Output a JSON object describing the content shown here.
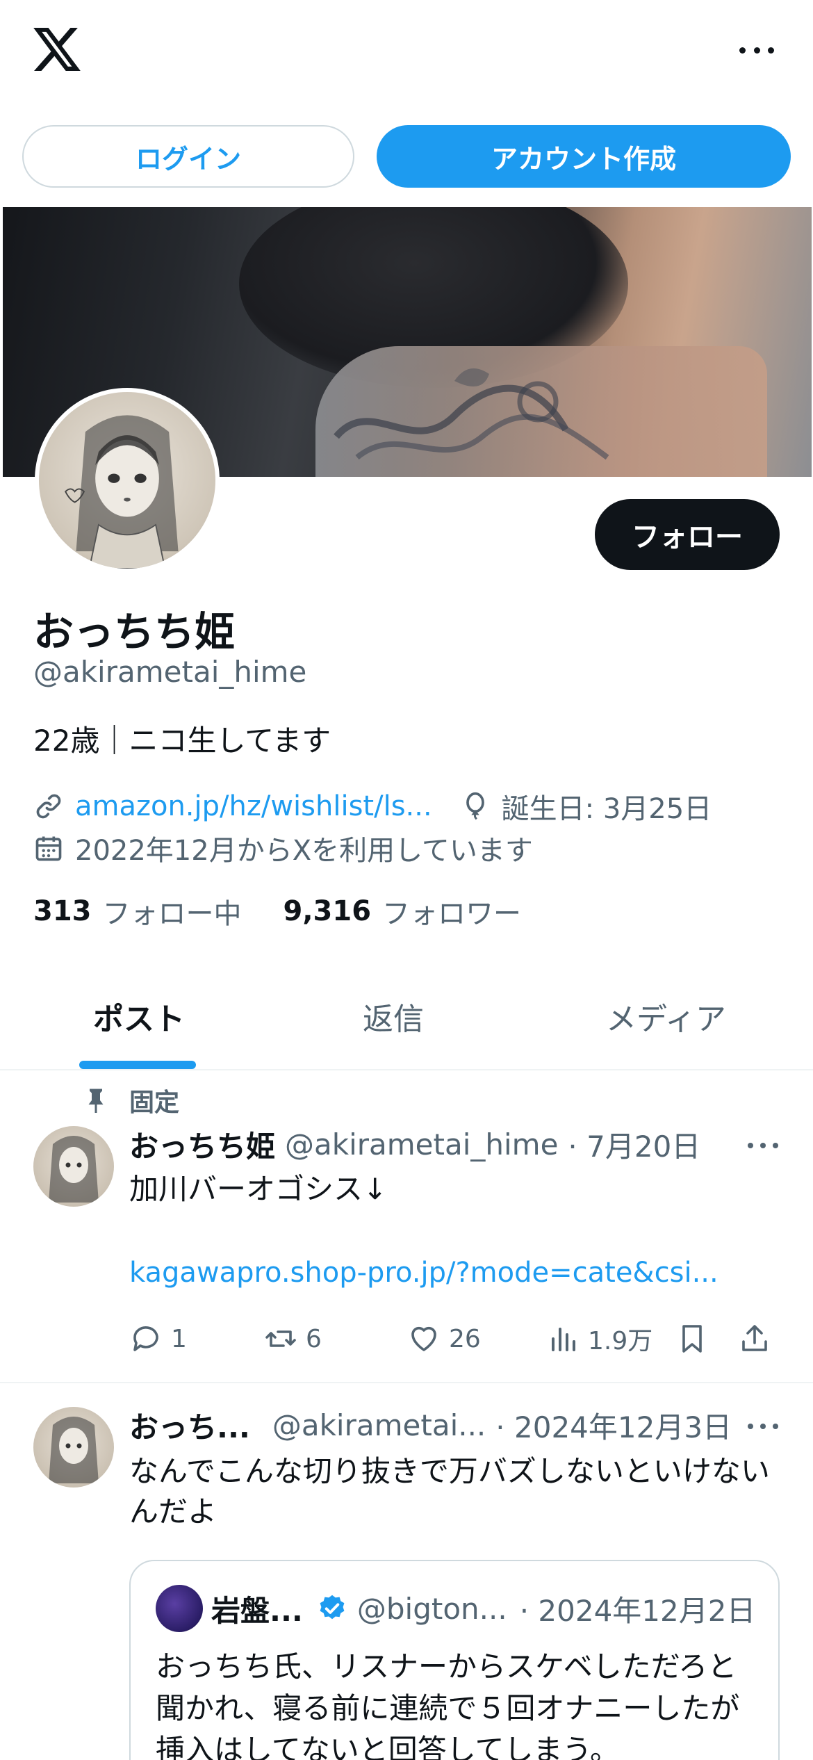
{
  "auth": {
    "login_label": "ログイン",
    "signup_label": "アカウント作成"
  },
  "profile": {
    "display_name": "おっちち姫",
    "handle": "@akirametai_hime",
    "bio": "22歳｜ニコ生してます",
    "link": "amazon.jp/hz/wishlist/ls...",
    "birthday": "誕生日: 3月25日",
    "joined": "2022年12月からXを利用しています",
    "following_count": "313",
    "following_label": "フォロー中",
    "followers_count": "9,316",
    "followers_label": "フォロワー",
    "follow_button": "フォロー"
  },
  "tabs": [
    "ポスト",
    "返信",
    "メディア"
  ],
  "pinned_label": "固定",
  "posts": [
    {
      "name": "おっちち姫",
      "handle": "@akirametai_hime",
      "date": "· 7月20日",
      "text": "加川バーオゴシス↓",
      "link": "kagawapro.shop-pro.jp/?mode=cate&csi...",
      "replies": "1",
      "reposts": "6",
      "likes": "26",
      "views": "1.9万"
    },
    {
      "name": "おっち...",
      "handle": "@akirametai...",
      "date": "· 2024年12月3日",
      "text_line1": "なんでこんな切り抜きで万バズしないといけない",
      "text_line2": "んだよ",
      "quote": {
        "name": "岩盤...",
        "handle": "@bigton...",
        "date": "· 2024年12月2日",
        "line1": "おっちち氏、リスナーからスケベしただろと",
        "line2": "聞かれ、寝る前に連続で５回オナニーしたが",
        "line3": "挿入はしてないと回答してしまう。"
      }
    }
  ],
  "colors": {
    "accent": "#1d9bf0",
    "text": "#0f1419",
    "secondary": "#536471",
    "border": "#cfd9de"
  }
}
